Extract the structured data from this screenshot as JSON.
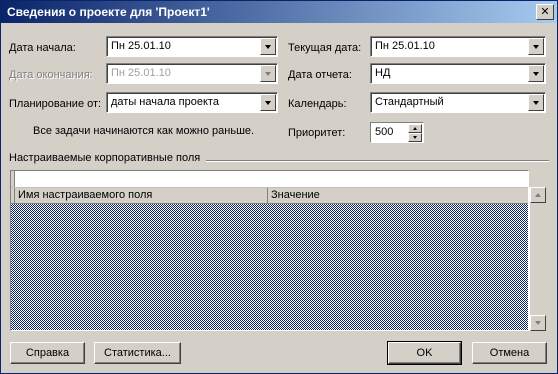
{
  "window": {
    "title": "Сведения о проекте для 'Проект1'",
    "close_glyph": "✕"
  },
  "fields": {
    "start_date": {
      "label": "Дата начала:",
      "value": "Пн 25.01.10"
    },
    "finish_date": {
      "label": "Дата окончания:",
      "value": "Пн 25.01.10",
      "disabled": true
    },
    "schedule_from": {
      "label": "Планирование от:",
      "value": "даты начала проекта"
    },
    "schedule_note": "Все задачи начинаются как можно раньше.",
    "current_date": {
      "label": "Текущая дата:",
      "value": "Пн 25.01.10"
    },
    "status_date": {
      "label": "Дата отчета:",
      "value": "НД"
    },
    "calendar": {
      "label": "Календарь:",
      "value": "Стандартный"
    },
    "priority": {
      "label": "Приоритет:",
      "value": "500"
    }
  },
  "custom_fields": {
    "group_label": "Настраиваемые корпоративные поля",
    "columns": [
      "Имя настраиваемого поля",
      "Значение"
    ]
  },
  "buttons": {
    "help": "Справка",
    "statistics": "Статистика...",
    "ok": "OK",
    "cancel": "Отмена"
  },
  "colors": {
    "title_start": "#0a246a",
    "title_end": "#a6caf0",
    "dialog_bg": "#d4d0c8",
    "grid_selection": "#0a246a"
  }
}
